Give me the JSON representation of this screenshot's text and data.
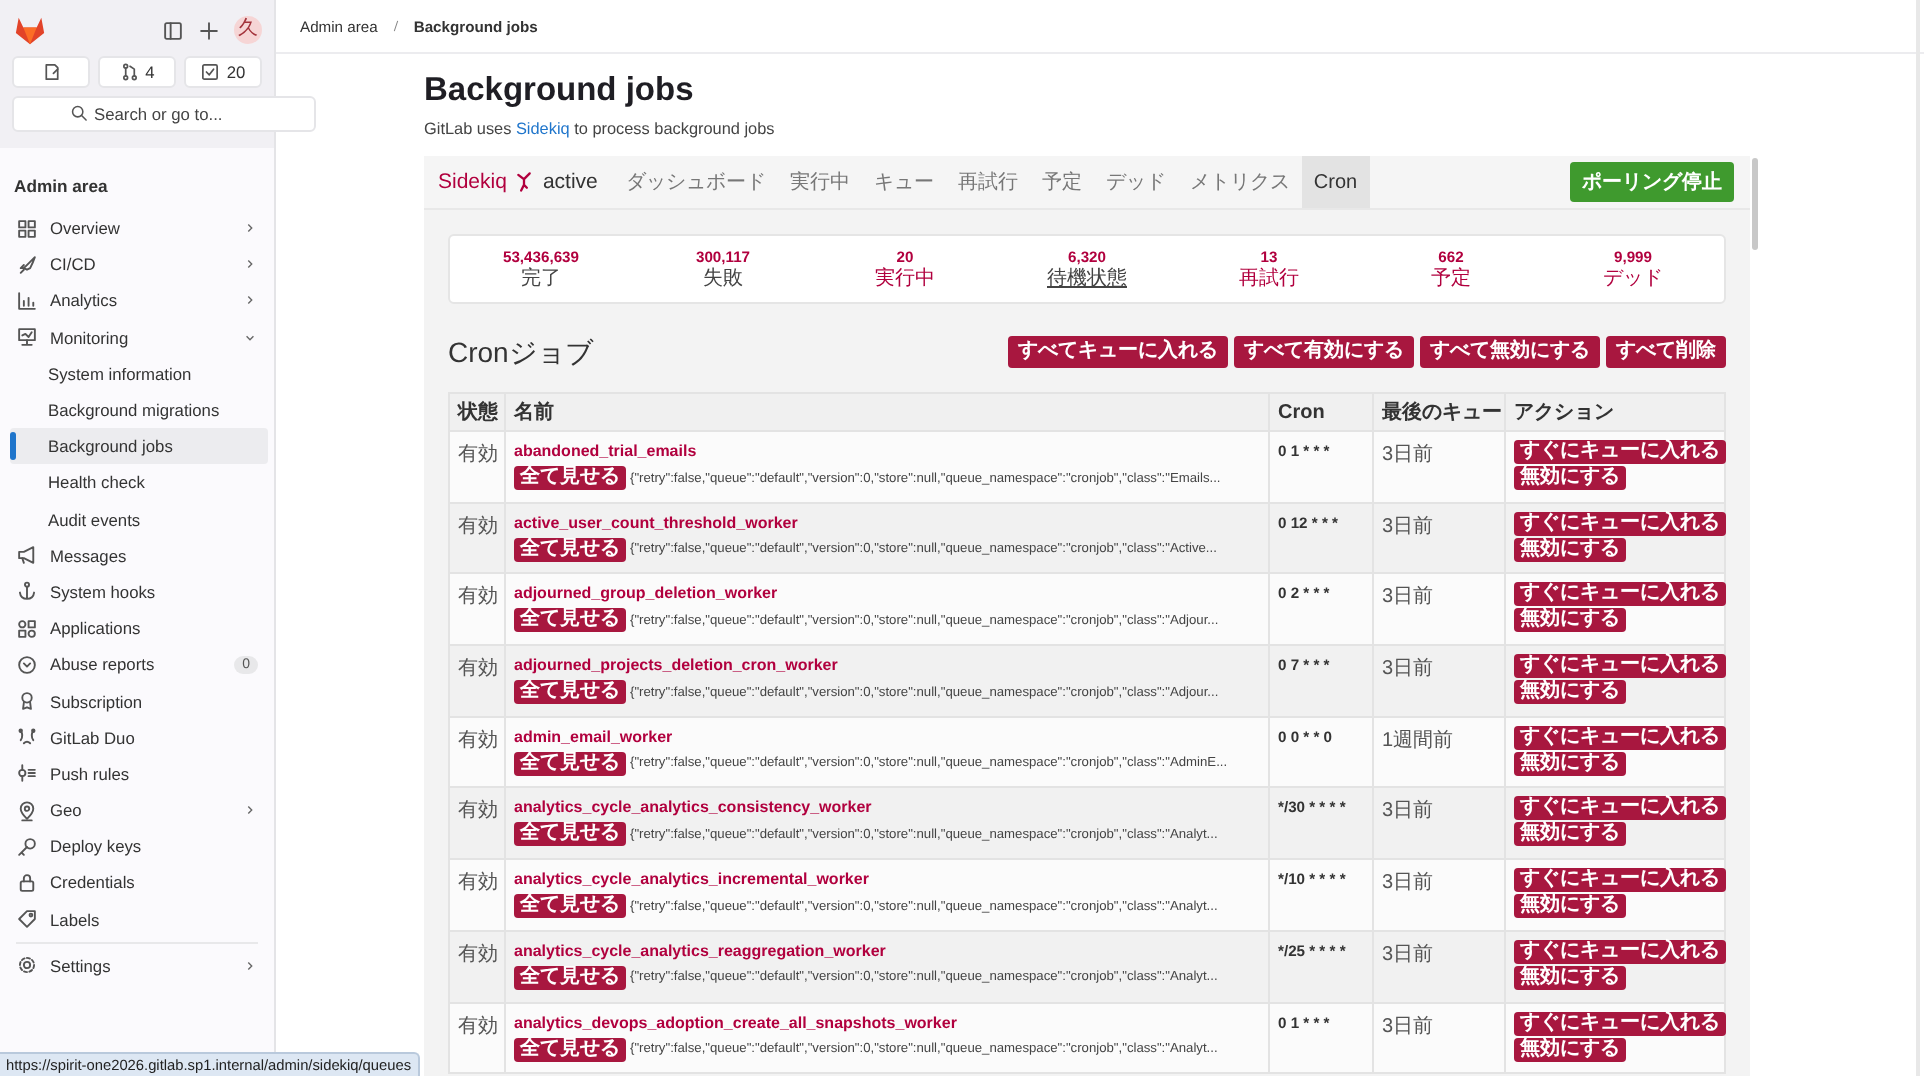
{
  "sidebar": {
    "avatar": "久",
    "top_buttons": [
      {
        "kind": "todo"
      },
      {
        "kind": "merge_requests",
        "count": "4"
      },
      {
        "kind": "todos",
        "count": "20"
      }
    ],
    "search": {
      "placeholder": "Search or go to..."
    },
    "section_title": "Admin area",
    "items": [
      {
        "label": "Overview",
        "kind": "group",
        "expanded": false,
        "selected": false
      },
      {
        "label": "CI/CD",
        "kind": "group",
        "expanded": false,
        "selected": false
      },
      {
        "label": "Analytics",
        "kind": "group",
        "expanded": false,
        "selected": false
      },
      {
        "label": "Monitoring",
        "kind": "group",
        "expanded": true,
        "selected": false,
        "children": [
          {
            "label": "System information",
            "selected": false
          },
          {
            "label": "Background migrations",
            "selected": false
          },
          {
            "label": "Background jobs",
            "selected": true
          },
          {
            "label": "Health check",
            "selected": false
          },
          {
            "label": "Audit events",
            "selected": false
          }
        ]
      },
      {
        "label": "Messages",
        "kind": "link",
        "selected": false
      },
      {
        "label": "System hooks",
        "kind": "link",
        "selected": false
      },
      {
        "label": "Applications",
        "kind": "link",
        "selected": false
      },
      {
        "label": "Abuse reports",
        "kind": "link",
        "selected": false,
        "badge": "0"
      },
      {
        "label": "Subscription",
        "kind": "link",
        "selected": false
      },
      {
        "label": "GitLab Duo",
        "kind": "link",
        "selected": false
      },
      {
        "label": "Push rules",
        "kind": "link",
        "selected": false
      },
      {
        "label": "Geo",
        "kind": "group",
        "expanded": false,
        "selected": false
      },
      {
        "label": "Deploy keys",
        "kind": "link",
        "selected": false
      },
      {
        "label": "Credentials",
        "kind": "link",
        "selected": false
      },
      {
        "label": "Labels",
        "kind": "link",
        "selected": false
      },
      {
        "label": "Settings",
        "kind": "group",
        "expanded": false,
        "selected": false
      }
    ]
  },
  "breadcrumb": [
    "Admin area",
    "Background jobs"
  ],
  "title": "Background jobs",
  "subtitle": {
    "before": "GitLab uses ",
    "link": "Sidekiq",
    "after": " to process background jobs"
  },
  "sidekiq": {
    "brand": "Sidekiq",
    "status": "active",
    "tabs": [
      {
        "label": "ダッシュボード",
        "selected": false
      },
      {
        "label": "実行中",
        "selected": false
      },
      {
        "label": "キュー",
        "selected": false
      },
      {
        "label": "再試行",
        "selected": false
      },
      {
        "label": "予定",
        "selected": false
      },
      {
        "label": "デッド",
        "selected": false
      },
      {
        "label": "メトリクス",
        "selected": false
      },
      {
        "label": "Cron",
        "selected": true
      }
    ],
    "poll_button": "ポーリング停止",
    "stats": [
      {
        "value": "53,436,639",
        "label": "完了",
        "kind": "plain"
      },
      {
        "value": "300,117",
        "label": "失敗",
        "kind": "plain"
      },
      {
        "value": "20",
        "label": "実行中",
        "kind": "link"
      },
      {
        "value": "6,320",
        "label": "待機状態",
        "kind": "underlined"
      },
      {
        "value": "13",
        "label": "再試行",
        "kind": "link"
      },
      {
        "value": "662",
        "label": "予定",
        "kind": "link"
      },
      {
        "value": "9,999",
        "label": "デッド",
        "kind": "link"
      }
    ],
    "section_title": "Cronジョブ",
    "bulk_buttons": [
      "すべてキューに入れる",
      "すべて有効にする",
      "すべて無効にする",
      "すべて削除"
    ],
    "table": {
      "columns": [
        "状態",
        "名前",
        "Cron",
        "最後のキュー",
        "アクション"
      ],
      "rows": [
        {
          "status": "有効",
          "name": "abandoned_trial_emails",
          "show_all": "全て見せる",
          "args": "{\"retry\":false,\"queue\":\"default\",\"version\":0,\"store\":null,\"queue_namespace\":\"cronjob\",\"class\":\"Emails...",
          "cron": "0 1 * * *",
          "last": "3日前",
          "actions": [
            "すぐにキューに入れる",
            "無効にする"
          ]
        },
        {
          "status": "有効",
          "name": "active_user_count_threshold_worker",
          "show_all": "全て見せる",
          "args": "{\"retry\":false,\"queue\":\"default\",\"version\":0,\"store\":null,\"queue_namespace\":\"cronjob\",\"class\":\"Active...",
          "cron": "0 12 * * *",
          "last": "3日前",
          "actions": [
            "すぐにキューに入れる",
            "無効にする"
          ]
        },
        {
          "status": "有効",
          "name": "adjourned_group_deletion_worker",
          "show_all": "全て見せる",
          "args": "{\"retry\":false,\"queue\":\"default\",\"version\":0,\"store\":null,\"queue_namespace\":\"cronjob\",\"class\":\"Adjour...",
          "cron": "0 2 * * *",
          "last": "3日前",
          "actions": [
            "すぐにキューに入れる",
            "無効にする"
          ]
        },
        {
          "status": "有効",
          "name": "adjourned_projects_deletion_cron_worker",
          "show_all": "全て見せる",
          "args": "{\"retry\":false,\"queue\":\"default\",\"version\":0,\"store\":null,\"queue_namespace\":\"cronjob\",\"class\":\"Adjour...",
          "cron": "0 7 * * *",
          "last": "3日前",
          "actions": [
            "すぐにキューに入れる",
            "無効にする"
          ]
        },
        {
          "status": "有効",
          "name": "admin_email_worker",
          "show_all": "全て見せる",
          "args": "{\"retry\":false,\"queue\":\"default\",\"version\":0,\"store\":null,\"queue_namespace\":\"cronjob\",\"class\":\"AdminE...",
          "cron": "0 0 * * 0",
          "last": "1週間前",
          "actions": [
            "すぐにキューに入れる",
            "無効にする"
          ]
        },
        {
          "status": "有効",
          "name": "analytics_cycle_analytics_consistency_worker",
          "show_all": "全て見せる",
          "args": "{\"retry\":false,\"queue\":\"default\",\"version\":0,\"store\":null,\"queue_namespace\":\"cronjob\",\"class\":\"Analyt...",
          "cron": "*/30 * * * *",
          "last": "3日前",
          "actions": [
            "すぐにキューに入れる",
            "無効にする"
          ]
        },
        {
          "status": "有効",
          "name": "analytics_cycle_analytics_incremental_worker",
          "show_all": "全て見せる",
          "args": "{\"retry\":false,\"queue\":\"default\",\"version\":0,\"store\":null,\"queue_namespace\":\"cronjob\",\"class\":\"Analyt...",
          "cron": "*/10 * * * *",
          "last": "3日前",
          "actions": [
            "すぐにキューに入れる",
            "無効にする"
          ]
        },
        {
          "status": "有効",
          "name": "analytics_cycle_analytics_reaggregation_worker",
          "show_all": "全て見せる",
          "args": "{\"retry\":false,\"queue\":\"default\",\"version\":0,\"store\":null,\"queue_namespace\":\"cronjob\",\"class\":\"Analyt...",
          "cron": "*/25 * * * *",
          "last": "3日前",
          "actions": [
            "すぐにキューに入れる",
            "無効にする"
          ]
        },
        {
          "status": "有効",
          "name": "analytics_devops_adoption_create_all_snapshots_worker",
          "show_all": "全て見せる",
          "args": "{\"retry\":false,\"queue\":\"default\",\"version\":0,\"store\":null,\"queue_namespace\":\"cronjob\",\"class\":\"Analyt...",
          "cron": "0 1 * * *",
          "last": "3日前",
          "actions": [
            "すぐにキューに入れる",
            "無効にする"
          ]
        }
      ]
    }
  },
  "status_url": "https://spirit-one2026.gitlab.sp1.internal/admin/sidekiq/queues"
}
